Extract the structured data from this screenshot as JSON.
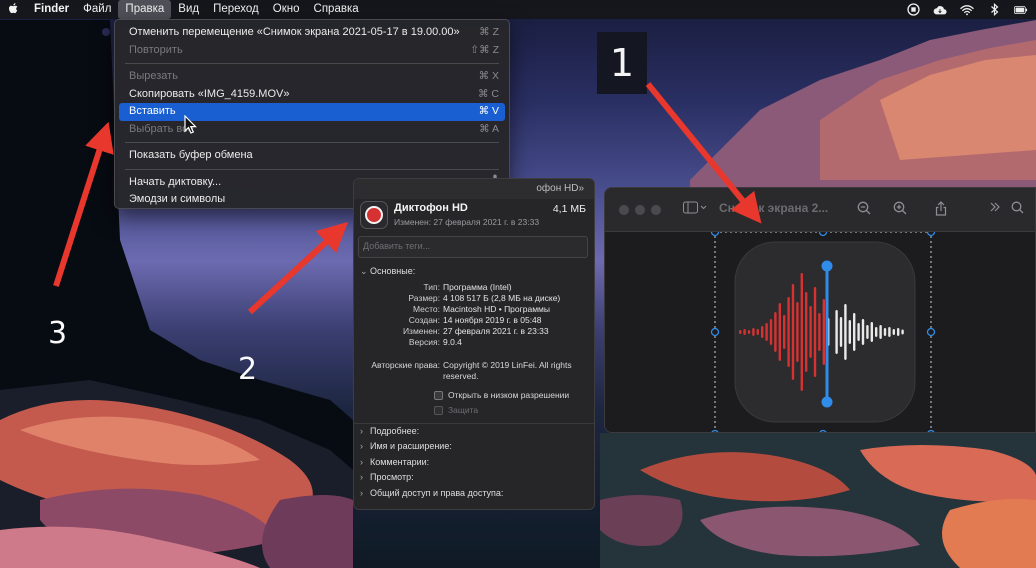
{
  "menubar": {
    "app": "Finder",
    "items": [
      "Файл",
      "Правка",
      "Вид",
      "Переход",
      "Окно",
      "Справка"
    ],
    "active_index": 1
  },
  "edit_menu": {
    "items": [
      {
        "label": "Отменить перемещение «Снимок экрана 2021-05-17 в 19.00.00»",
        "shortcut": "⌘ Z",
        "state": "enabled"
      },
      {
        "label": "Повторить",
        "shortcut": "⇧⌘ Z",
        "state": "disabled"
      },
      {
        "label": "Вырезать",
        "shortcut": "⌘ X",
        "state": "disabled"
      },
      {
        "label": "Скопировать «IMG_4159.MOV»",
        "shortcut": "⌘ C",
        "state": "enabled"
      },
      {
        "label": "Вставить",
        "shortcut": "⌘ V",
        "state": "highlighted"
      },
      {
        "label": "Выбрать все",
        "shortcut": "⌘ A",
        "state": "disabled"
      },
      {
        "label": "Показать буфер обмена",
        "shortcut": "",
        "state": "enabled"
      },
      {
        "label": "Начать диктовку...",
        "shortcut": "mic-icon",
        "state": "enabled"
      },
      {
        "label": "Эмодзи и символы",
        "shortcut": "globe-icon",
        "state": "enabled"
      }
    ]
  },
  "info_window": {
    "title": "офон HD»",
    "app_name": "Диктофон HD",
    "size": "4,1 МБ",
    "modified_line": "Изменен: 27 февраля 2021 г. в 23:33",
    "tags_placeholder": "Добавить теги...",
    "general_header": "Основные:",
    "general": [
      {
        "k": "Тип:",
        "v": "Программа (Intel)"
      },
      {
        "k": "Размер:",
        "v": "4 108 517 Б (2,8 МБ на диске)"
      },
      {
        "k": "Место:",
        "v": "Macintosh HD • Программы"
      },
      {
        "k": "Создан:",
        "v": "14 ноября 2019 г. в 05:48"
      },
      {
        "k": "Изменен:",
        "v": "27 февраля 2021 г. в 23:33"
      },
      {
        "k": "Версия:",
        "v": "9.0.4"
      }
    ],
    "copyright_key": "Авторские права:",
    "copyright_value": "Copyright © 2019 LinFei. All rights reserved.",
    "checkbox_lowres": "Открыть в низком разрешении",
    "checkbox_locked": "Защита",
    "sections": [
      "Подробнее:",
      "Имя и расширение:",
      "Комментарии:",
      "Просмотр:",
      "Общий доступ и права доступа:"
    ]
  },
  "preview_window": {
    "title": "Снимок экрана 2..."
  },
  "annotations": {
    "label_1": "1",
    "label_2": "2",
    "label_3": "3",
    "arrow_color": "#e8372c"
  },
  "colors": {
    "menu_highlight": "#1a5fd1",
    "record_red": "#d63232",
    "playhead_blue": "#2f8ce8"
  }
}
